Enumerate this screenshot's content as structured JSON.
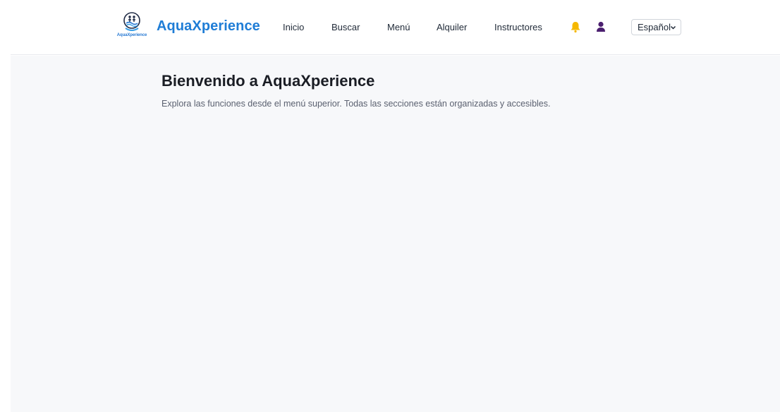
{
  "brand": {
    "name": "AquaXperience",
    "logo_caption": "AquaXperience"
  },
  "nav": {
    "items": [
      {
        "label": "Inicio"
      },
      {
        "label": "Buscar"
      },
      {
        "label": "Menú"
      },
      {
        "label": "Alquiler"
      },
      {
        "label": "Instructores"
      }
    ]
  },
  "icons": {
    "notifications": "bell-icon",
    "profile": "user-icon",
    "language_chevron": "chevron-down-icon"
  },
  "language": {
    "selected": "Español"
  },
  "main": {
    "title": "Bienvenido a AquaXperience",
    "description": "Explora las funciones desde el menú superior. Todas las secciones están organizadas y accesibles."
  },
  "colors": {
    "brand": "#1f7dd6",
    "bell": "#f5b800",
    "user": "#4b1f6f",
    "background": "#f7f8fa"
  }
}
